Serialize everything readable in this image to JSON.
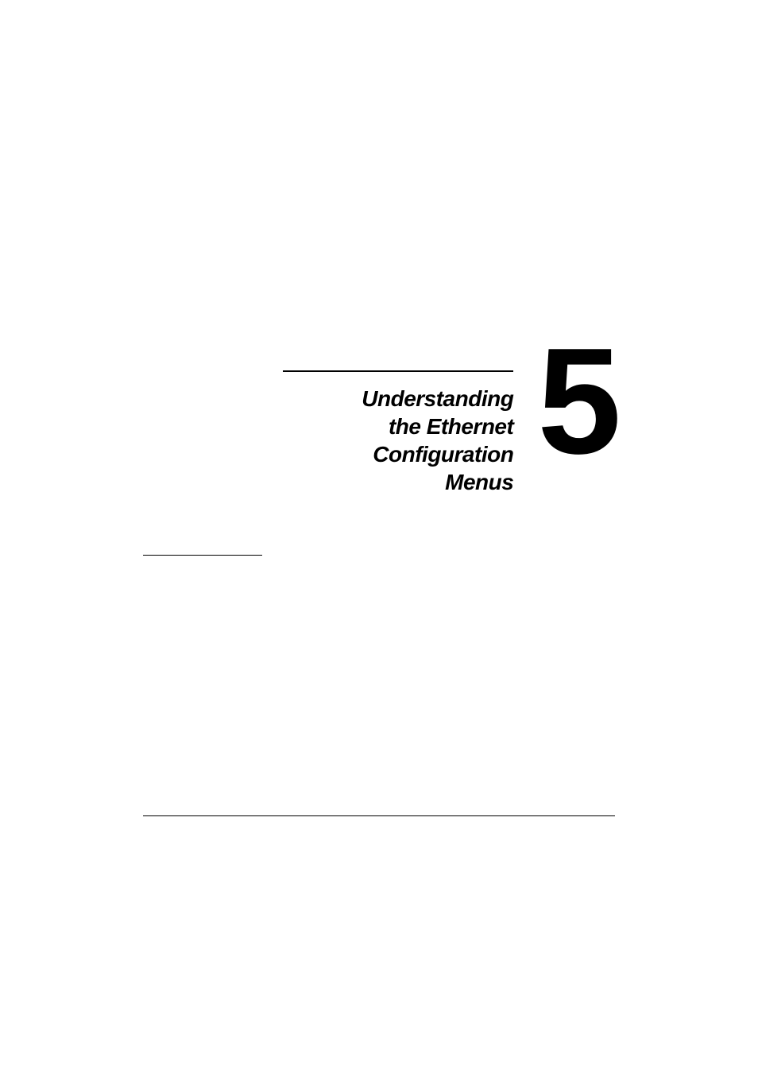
{
  "chapter": {
    "title_line1": "Understanding",
    "title_line2": "the Ethernet",
    "title_line3": "Configuration",
    "title_line4": "Menus",
    "number": "5"
  }
}
